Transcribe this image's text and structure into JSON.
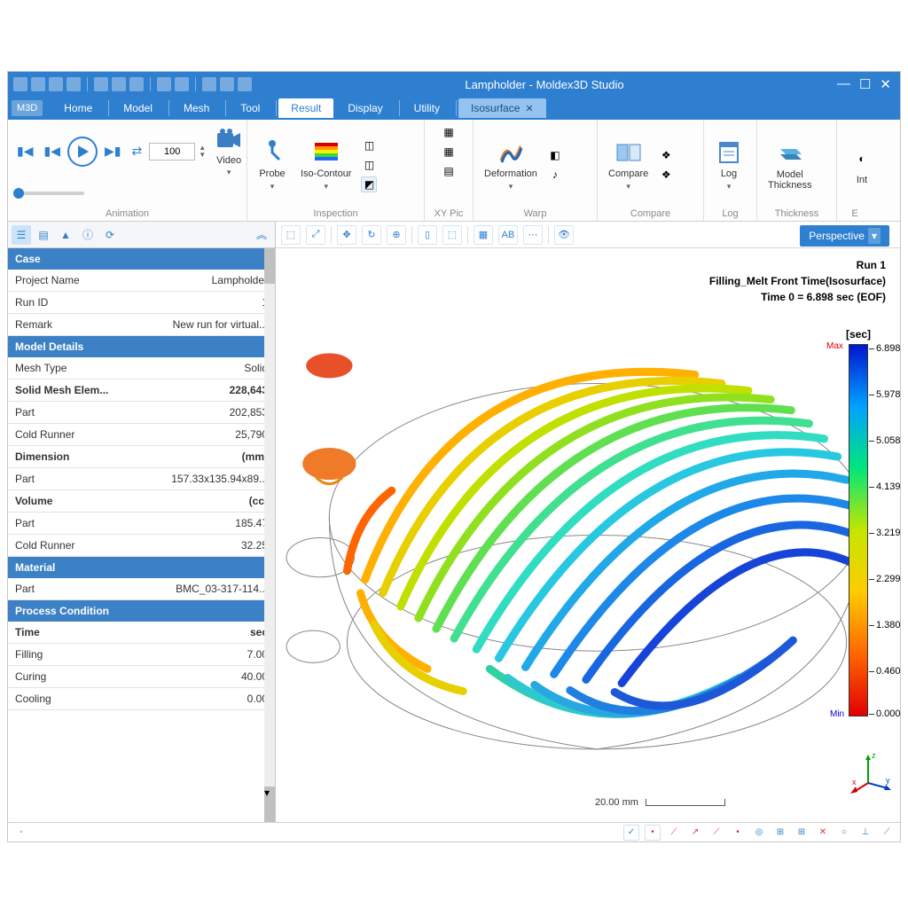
{
  "title": "Lampholder - Moldex3D Studio",
  "tabs": [
    "Home",
    "Model",
    "Mesh",
    "Tool",
    "Result",
    "Display",
    "Utility"
  ],
  "active_tab": "Result",
  "sub_tab": "Isosurface",
  "ribbon": {
    "animation": {
      "label": "Animation",
      "frame": "100"
    },
    "inspection": {
      "label": "Inspection",
      "video": "Video",
      "probe": "Probe",
      "iso": "Iso-Contour"
    },
    "xypic": {
      "label": "XY Pic"
    },
    "warp": {
      "label": "Warp",
      "deformation": "Deformation"
    },
    "compare": {
      "label": "Compare",
      "btn": "Compare"
    },
    "log": {
      "label": "Log",
      "btn": "Log"
    },
    "thickness": {
      "label": "Thickness",
      "btn": "Model\nThickness"
    },
    "int": {
      "label": "E",
      "btn": "Int"
    }
  },
  "panel": {
    "sections": {
      "case": "Case",
      "model": "Model Details",
      "material": "Material",
      "process": "Process Condition"
    },
    "rows": {
      "project_name_k": "Project Name",
      "project_name_v": "Lampholder",
      "run_id_k": "Run ID",
      "run_id_v": "1",
      "remark_k": "Remark",
      "remark_v": "New run for virtual...",
      "mesh_type_k": "Mesh Type",
      "mesh_type_v": "Solid",
      "solid_mesh_k": "Solid Mesh Elem...",
      "solid_mesh_v": "228,643",
      "part_elem_k": "Part",
      "part_elem_v": "202,853",
      "cold_runner_k": "Cold Runner",
      "cold_runner_v": "25,790",
      "dimension_k": "Dimension",
      "dimension_v": "(mm)",
      "part_dim_k": "Part",
      "part_dim_v": "157.33x135.94x89...",
      "volume_k": "Volume",
      "volume_v": "(cc)",
      "part_vol_k": "Part",
      "part_vol_v": "185.47",
      "coldr_vol_k": "Cold Runner",
      "coldr_vol_v": "32.25",
      "mat_part_k": "Part",
      "mat_part_v": "BMC_03-317-114...",
      "time_k": "Time",
      "time_v": "sec",
      "filling_k": "Filling",
      "filling_v": "7.00",
      "curing_k": "Curing",
      "curing_v": "40.00",
      "cooling_k": "Cooling",
      "cooling_v": "0.00"
    }
  },
  "viewport": {
    "perspective": "Perspective",
    "run": "Run 1",
    "result_name": "Filling_Melt Front Time(Isosurface)",
    "time": "Time 0 = 6.898 sec (EOF)",
    "scale": "20.00 mm"
  },
  "legend": {
    "unit": "[sec]",
    "max_label": "Max",
    "min_label": "Min",
    "ticks": [
      "6.898",
      "5.978",
      "5.058",
      "4.139",
      "3.219",
      "2.299",
      "1.380",
      "0.460",
      "0.000"
    ]
  },
  "axis": {
    "x": "x",
    "y": "y",
    "z": "z"
  }
}
